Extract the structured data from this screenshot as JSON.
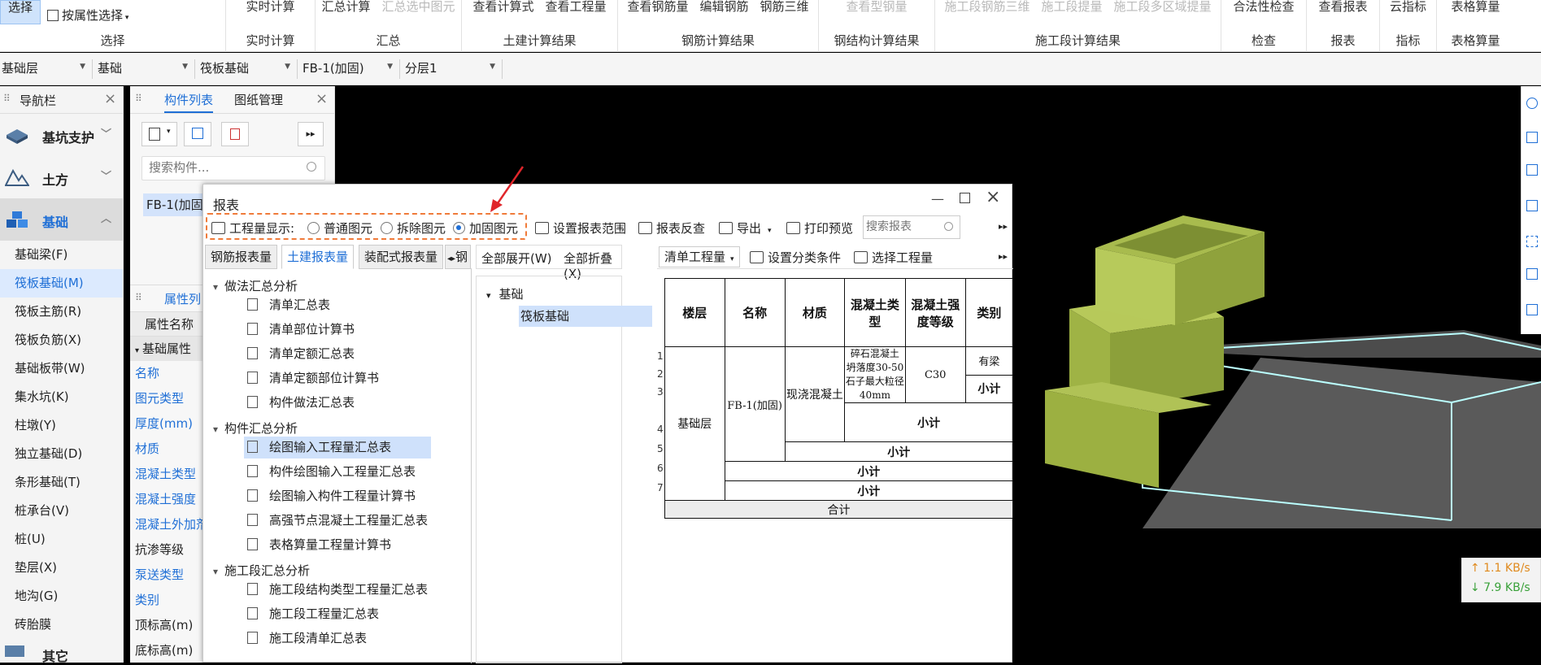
{
  "ribbon": {
    "select_btn": "选择",
    "attr_select": "按属性选择",
    "groups": [
      {
        "label": "选择",
        "buttons": []
      },
      {
        "label": "实时计算",
        "buttons": [
          "实时计算"
        ]
      },
      {
        "label": "汇总",
        "buttons": [
          "汇总计算",
          "汇总选中图元"
        ]
      },
      {
        "label": "土建计算结果",
        "buttons": [
          "查看计算式",
          "查看工程量"
        ]
      },
      {
        "label": "钢筋计算结果",
        "buttons": [
          "查看钢筋量",
          "编辑钢筋",
          "钢筋三维"
        ]
      },
      {
        "label": "钢结构计算结果",
        "buttons": [
          "查看型钢量"
        ]
      },
      {
        "label": "施工段计算结果",
        "buttons": [
          "施工段钢筋三维",
          "施工段提量",
          "施工段多区域提量"
        ]
      },
      {
        "label": "检查",
        "buttons": [
          "合法性检查"
        ]
      },
      {
        "label": "报表",
        "buttons": [
          "查看报表"
        ]
      },
      {
        "label": "指标",
        "buttons": [
          "云指标"
        ]
      },
      {
        "label": "表格算量",
        "buttons": [
          "表格算量"
        ]
      }
    ]
  },
  "filters": [
    "基础层",
    "基础",
    "筏板基础",
    "FB-1(加固)",
    "分层1"
  ],
  "nav": {
    "title": "导航栏",
    "cats": [
      {
        "label": "基坑支护"
      },
      {
        "label": "土方"
      },
      {
        "label": "基础"
      }
    ],
    "items": [
      "基础梁(F)",
      "筏板基础(M)",
      "筏板主筋(R)",
      "筏板负筋(X)",
      "基础板带(W)",
      "集水坑(K)",
      "柱墩(Y)",
      "独立基础(D)",
      "条形基础(T)",
      "桩承台(V)",
      "桩(U)",
      "垫层(X)",
      "地沟(G)",
      "砖胎膜"
    ],
    "bottom_cat": "其它"
  },
  "comp": {
    "tab1": "构件列表",
    "tab2": "图纸管理",
    "search_placeholder": "搜索构件...",
    "item": "FB-1(加固",
    "attr_tab": "属性列",
    "attr_header": "属性名称",
    "attr_group": "基础属性",
    "attrs": [
      "名称",
      "图元类型",
      "厚度(mm)",
      "材质",
      "混凝土类型",
      "混凝土强度",
      "混凝土外加剂",
      "抗渗等级",
      "泵送类型",
      "类别",
      "顶标高(m)",
      "底标高(m)"
    ]
  },
  "dialog": {
    "title": "报表",
    "display_label": "工程量显示:",
    "radios": [
      "普通图元",
      "拆除图元",
      "加固图元"
    ],
    "toolbar": [
      "设置报表范围",
      "报表反查",
      "导出",
      "打印预览"
    ],
    "search_placeholder": "搜索报表",
    "tabs": [
      "钢筋报表量",
      "土建报表量",
      "装配式报表量",
      "钢"
    ],
    "tree": {
      "g1": "做法汇总分析",
      "g1_items": [
        "清单汇总表",
        "清单部位计算书",
        "清单定额汇总表",
        "清单定额部位计算书",
        "构件做法汇总表"
      ],
      "g2": "构件汇总分析",
      "g2_items": [
        "绘图输入工程量汇总表",
        "构件绘图输入工程量汇总表",
        "绘图输入构件工程量计算书",
        "高强节点混凝土工程量汇总表",
        "表格算量工程量计算书"
      ],
      "g3": "施工段汇总分析",
      "g3_items": [
        "施工段结构类型工程量汇总表",
        "施工段工程量汇总表",
        "施工段清单汇总表"
      ]
    },
    "mid": {
      "expand": "全部展开(W)",
      "collapse": "全部折叠(X)",
      "root": "基础",
      "child": "筏板基础"
    },
    "right_toolbar": [
      "清单工程量",
      "设置分类条件",
      "选择工程量"
    ],
    "table": {
      "headers": [
        "楼层",
        "名称",
        "材质",
        "混凝土类型",
        "混凝土强度等级",
        "类别"
      ],
      "floor": "基础层",
      "name": "FB-1(加固)",
      "material": "现浇混凝土",
      "ctype": "碎石混凝土 坍落度30-50 石子最大粒径40mm",
      "grade": "C30",
      "cat": "有梁",
      "subtotal": "小计",
      "subtotal_short": "小计",
      "total": "合计",
      "rows": [
        "1",
        "2",
        "3",
        "4",
        "5",
        "6",
        "7"
      ]
    }
  },
  "speed": {
    "up": "1.1 KB/s",
    "down": "7.9 KB/s"
  }
}
